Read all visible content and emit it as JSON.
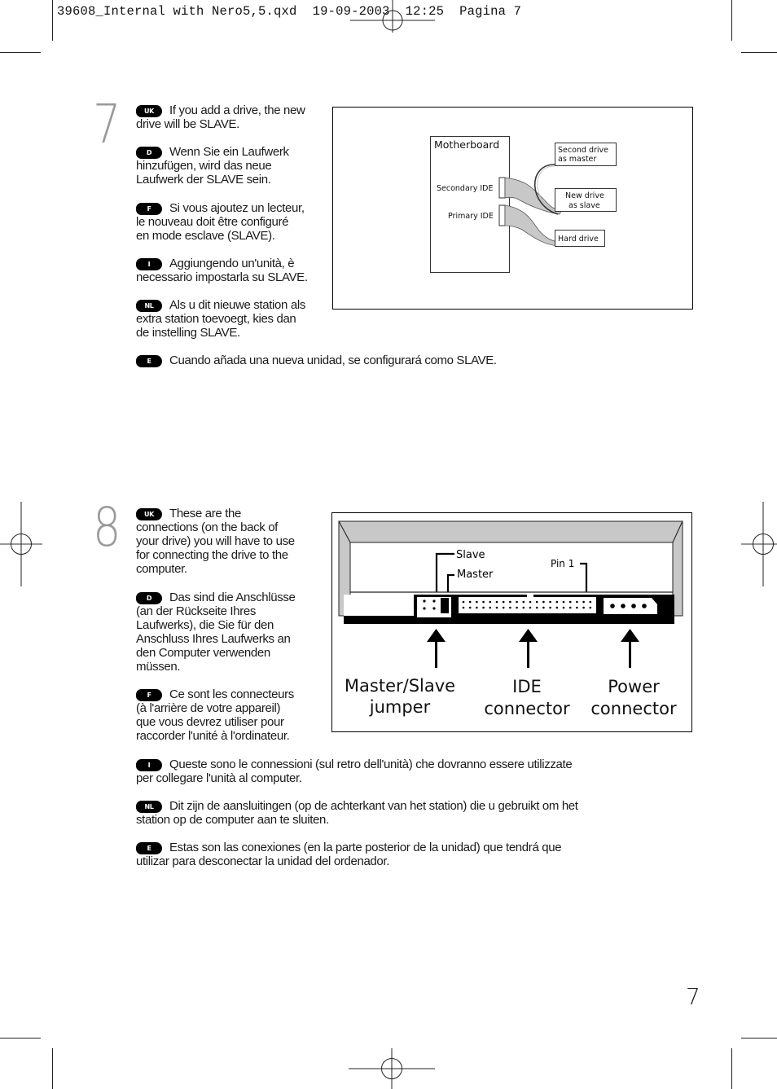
{
  "slug": {
    "filename": "39608_Internal with Nero5,5.qxd",
    "date": "19-09-2003",
    "time": "12:25",
    "page_label": "Pagina 7"
  },
  "steps": [
    {
      "number": "7",
      "paragraphs": [
        {
          "lang": "UK",
          "text": "If you add a drive, the new drive will be SLAVE.",
          "lines": [
            "If you add a drive, the new",
            "drive will be SLAVE."
          ]
        },
        {
          "lang": "D",
          "text": "Wenn Sie ein Laufwerk hinzufügen, wird das neue Laufwerk der SLAVE sein.",
          "lines": [
            "Wenn Sie ein Laufwerk",
            "hinzufügen, wird das neue",
            "Laufwerk der SLAVE sein."
          ]
        },
        {
          "lang": "F",
          "text": "Si vous ajoutez un lecteur, le nouveau doit être configuré en mode esclave (SLAVE).",
          "lines": [
            "Si vous ajoutez un lecteur,",
            "le nouveau doit être configuré",
            "en mode esclave (SLAVE)."
          ]
        },
        {
          "lang": "I",
          "text": "Aggiungendo un'unità, è necessario impostarla su SLAVE.",
          "lines": [
            "Aggiungendo un'unità, è",
            "necessario impostarla su SLAVE."
          ]
        },
        {
          "lang": "NL",
          "text": "Als u dit nieuwe station als extra station toevoegt, kies dan de instelling SLAVE.",
          "lines": [
            "Als u dit nieuwe station als",
            "extra station toevoegt, kies dan",
            "de instelling SLAVE."
          ]
        },
        {
          "lang": "E",
          "text": "Cuando añada una nueva unidad, se configurará como SLAVE.",
          "lines": [
            "Cuando añada una nueva unidad, se configurará como SLAVE."
          ]
        }
      ],
      "figure": {
        "motherboard": "Motherboard",
        "secondary_ide": "Secondary IDE",
        "primary_ide": "Primary IDE",
        "second_drive": [
          "Second drive",
          "as master"
        ],
        "new_drive": [
          "New drive",
          "as slave"
        ],
        "hard_drive": "Hard drive"
      }
    },
    {
      "number": "8",
      "paragraphs": [
        {
          "lang": "UK",
          "text": "These are the connections (on the back of your drive) you will have to use for connecting the drive to the computer.",
          "lines": [
            "These are the",
            "connections (on the back of",
            "your drive) you will have to use",
            "for connecting the drive to the",
            "computer."
          ]
        },
        {
          "lang": "D",
          "text": "Das sind die Anschlüsse (an der Rückseite Ihres Laufwerks), die Sie für den Anschluss Ihres Laufwerks an den Computer verwenden müssen.",
          "lines": [
            "Das sind die Anschlüsse",
            "(an der Rückseite Ihres",
            "Laufwerks), die Sie für den",
            "Anschluss Ihres Laufwerks an",
            "den Computer verwenden",
            "müssen."
          ]
        },
        {
          "lang": "F",
          "text": "Ce sont les connecteurs (à l'arrière de votre appareil) que vous devrez utiliser pour raccorder l'unité à l'ordinateur.",
          "lines": [
            "Ce sont les connecteurs",
            "(à l'arrière de votre appareil)",
            "que vous devrez utiliser pour",
            "raccorder l'unité à l'ordinateur."
          ]
        },
        {
          "lang": "I",
          "text": "Queste sono le connessioni (sul retro dell'unità) che dovranno essere utilizzate per collegare l'unità al computer.",
          "lines": [
            "Queste sono le connessioni (sul retro dell'unità) che dovranno essere utilizzate",
            "per collegare l'unità al computer."
          ]
        },
        {
          "lang": "NL",
          "text": "Dit zijn de aansluitingen (op de achterkant van het station) die u gebruikt om het station op de computer aan te sluiten.",
          "lines": [
            "Dit zijn de aansluitingen (op de achterkant van het station) die u gebruikt om het",
            "station op de computer aan te sluiten."
          ]
        },
        {
          "lang": "E",
          "text": "Estas son las conexiones (en la parte posterior de la unidad) que tendrá que utilizar para desconectar la unidad del ordenador.",
          "lines": [
            "Estas son las conexiones (en la parte posterior de la unidad) que tendrá que",
            "utilizar para desconectar la unidad del ordenador."
          ]
        }
      ],
      "figure": {
        "slave": "Slave",
        "master": "Master",
        "pin1": "Pin 1",
        "jumper_label": [
          "Master/Slave",
          "jumper"
        ],
        "ide_label": [
          "IDE",
          "connector"
        ],
        "power_label": [
          "Power",
          "connector"
        ]
      }
    }
  ],
  "page_number": "7"
}
